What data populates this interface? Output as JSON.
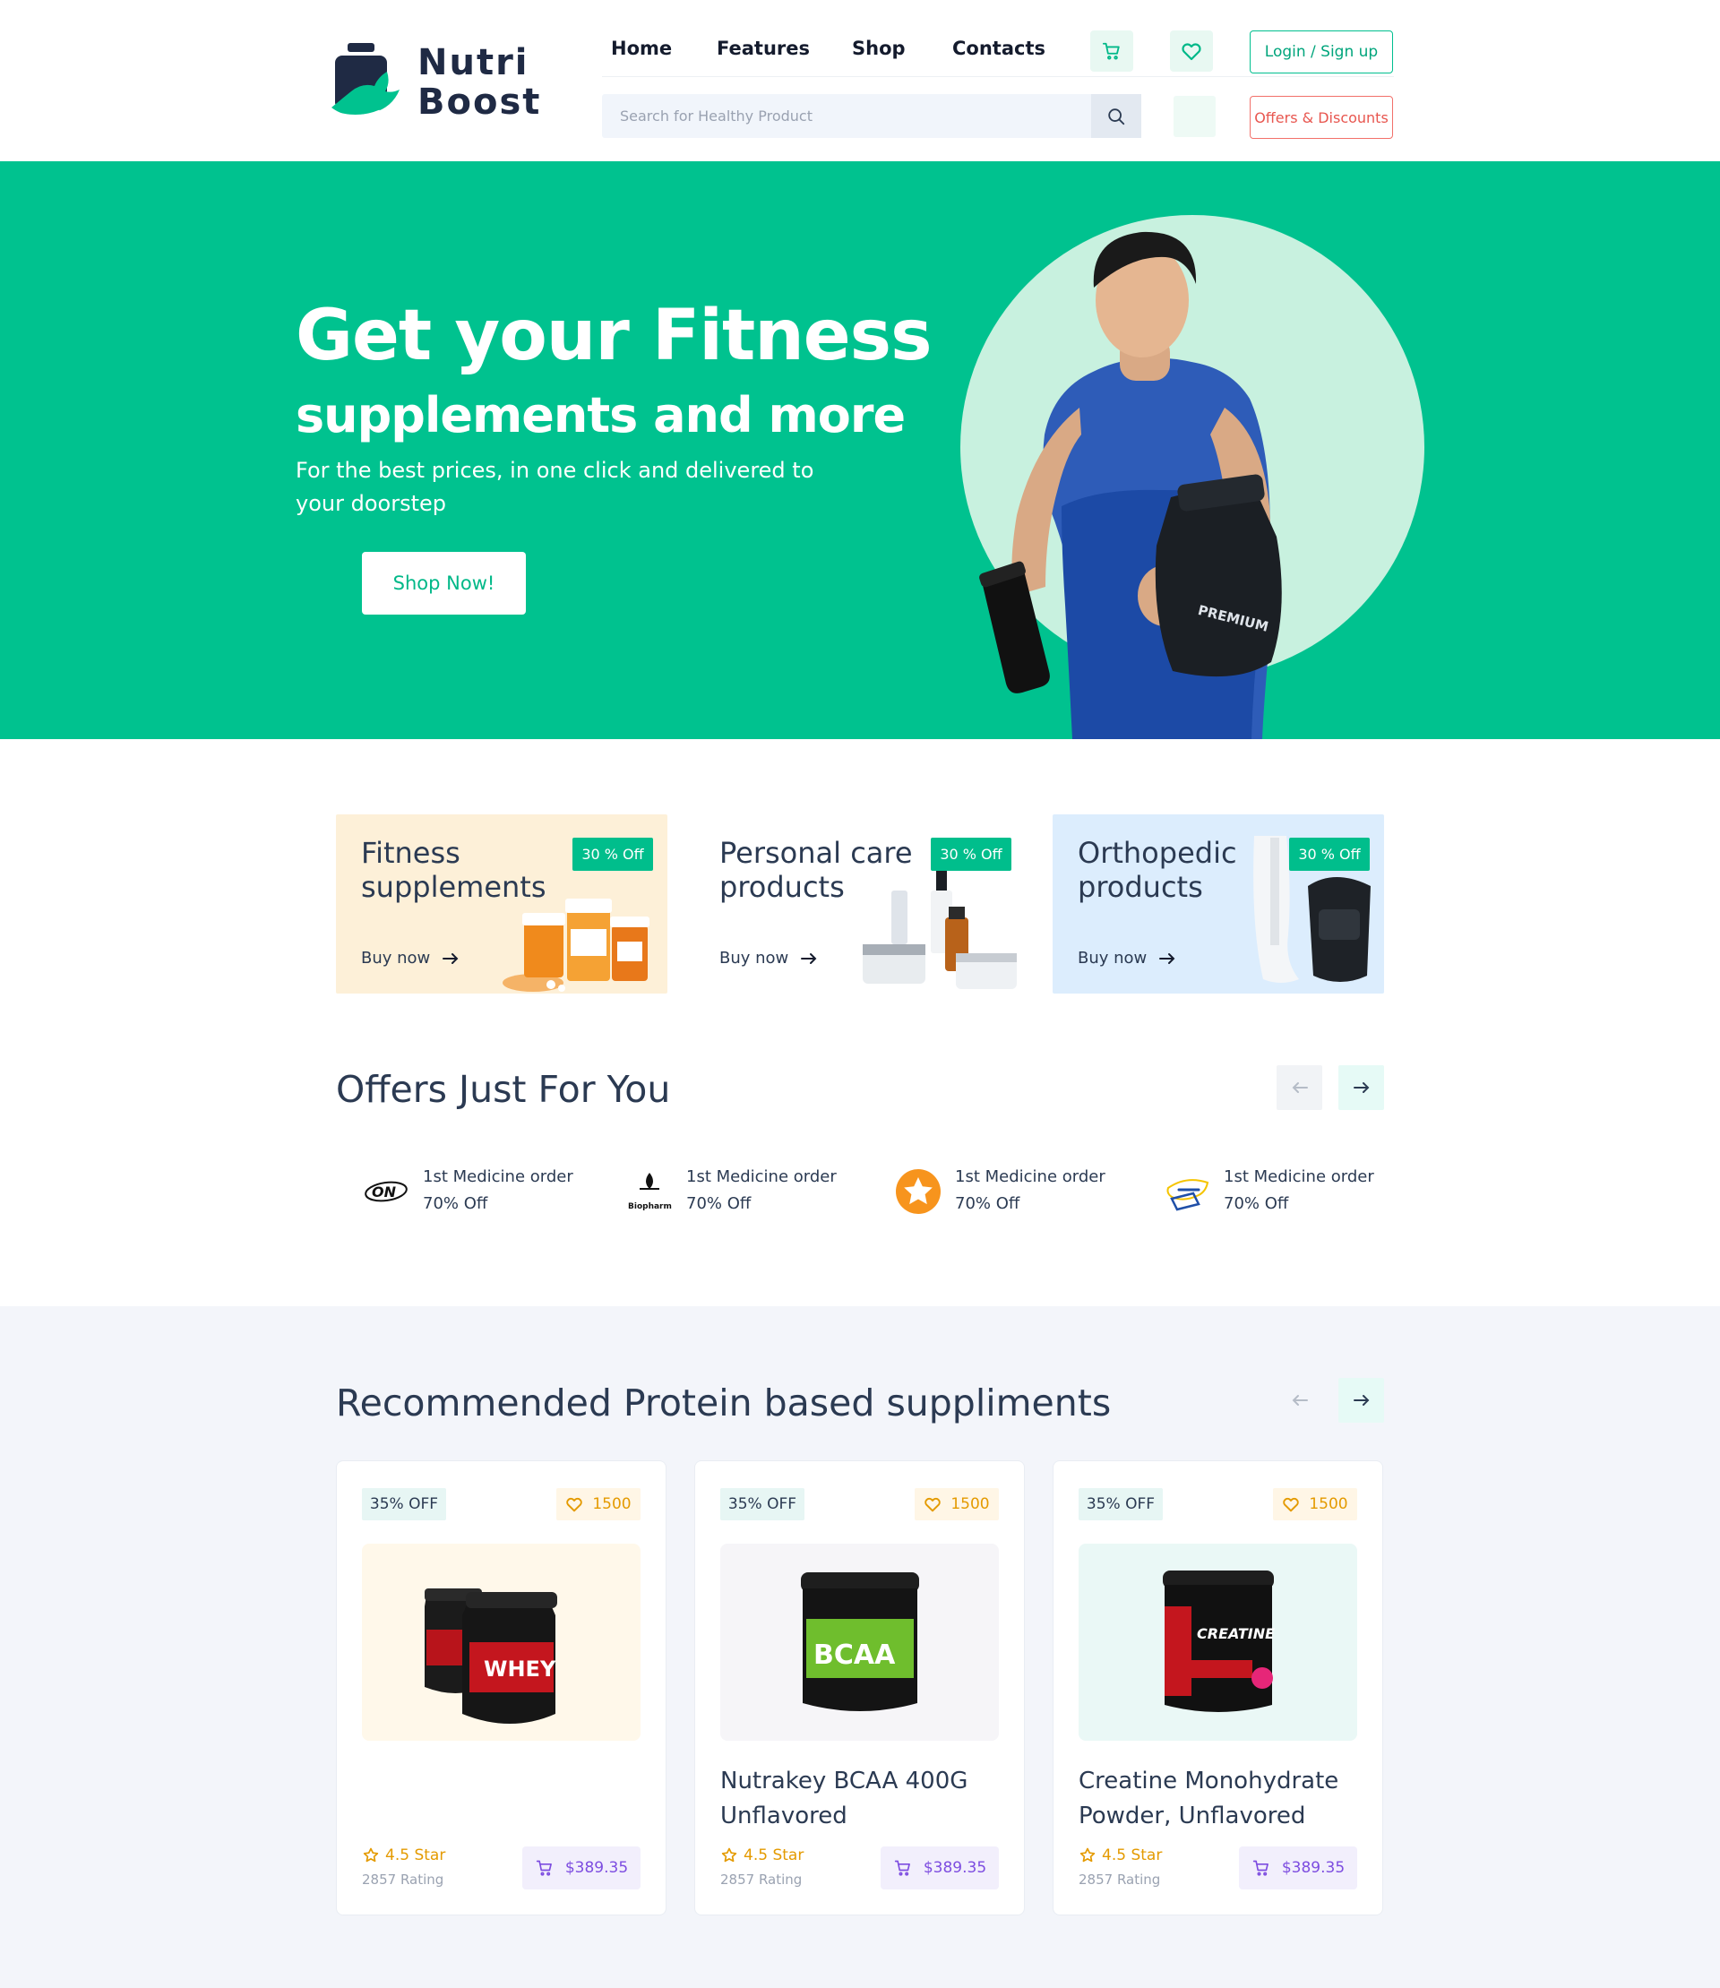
{
  "brand": {
    "name_line1": "Nutri",
    "name_line2": "Boost"
  },
  "nav": {
    "links": [
      "Home",
      "Features",
      "Shop",
      "Contacts"
    ],
    "login_label": "Login / Sign up",
    "offers_label": "Offers & Discounts",
    "search_placeholder": "Search for Healthy Product"
  },
  "hero": {
    "title": "Get your Fitness",
    "subtitle": "supplements and more",
    "description": "For the best prices, in one click and delivered to your doorstep",
    "cta": "Shop Now!",
    "tub_label": "PREMIUM"
  },
  "categories": [
    {
      "title": "Fitness supplements",
      "badge": "30 % Off",
      "cta": "Buy now",
      "bg": "#fdf0d8"
    },
    {
      "title": "Personal care products",
      "badge": "30 % Off",
      "cta": "Buy now",
      "bg": "#ffffff"
    },
    {
      "title": "Orthopedic products",
      "badge": "30 % Off",
      "cta": "Buy now",
      "bg": "#dcedfd"
    }
  ],
  "offers": {
    "title": "Offers Just For You",
    "items": [
      {
        "line1": "1st Medicine order",
        "line2": "70% Off",
        "logo_text": "ON"
      },
      {
        "line1": "1st Medicine order",
        "line2": "70% Off",
        "logo_text": "Biopharm"
      },
      {
        "line1": "1st Medicine order",
        "line2": "70% Off"
      },
      {
        "line1": "1st Medicine order",
        "line2": "70% Off"
      }
    ]
  },
  "recommended": {
    "title": "Recommended Protein based suppliments",
    "products": [
      {
        "discount": "35% OFF",
        "likes": "1500",
        "name": "",
        "stars": "4.5 Star",
        "rating": "2857 Rating",
        "price": "$389.35",
        "bg": "#fff8ea",
        "tub_label": "WHEY"
      },
      {
        "discount": "35% OFF",
        "likes": "1500",
        "name": "Nutrakey BCAA 400G Unflavored",
        "stars": "4.5 Star",
        "rating": "2857 Rating",
        "price": "$389.35",
        "bg": "#f6f5f8",
        "tub_label": "BCAA"
      },
      {
        "discount": "35% OFF",
        "likes": "1500",
        "name": "Creatine Monohydrate Powder, Unflavored",
        "stars": "4.5 Star",
        "rating": "2857 Rating",
        "price": "$389.35",
        "bg": "#eaf8f6",
        "tub_label": "CREATINE"
      }
    ]
  },
  "colors": {
    "primary": "#00c28f",
    "accent_red": "#e8564f",
    "price": "#7d4de0",
    "star": "#e49a00"
  }
}
